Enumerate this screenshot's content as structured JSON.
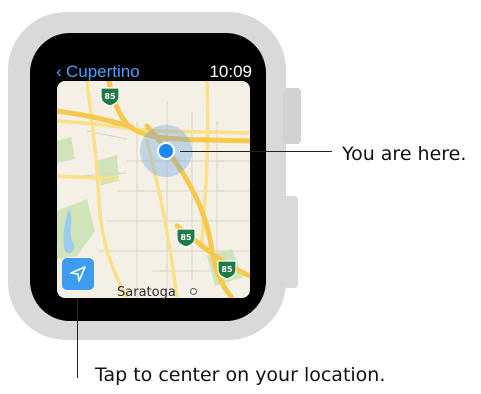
{
  "watch": {
    "back_chevron": "‹",
    "back_label": "Cupertino",
    "time": "10:09"
  },
  "map": {
    "highway_shields": [
      "85",
      "85",
      "85"
    ],
    "place_label": "Saratoga",
    "colors": {
      "land": "#f4f0e6",
      "park": "#cfe4b8",
      "water": "#9ccbf0",
      "highway": "#f6c84c",
      "major_road": "#fbe08a",
      "minor_road": "#d8d3c6",
      "shield": "#1f7a44",
      "location": "#1f87f2"
    }
  },
  "callouts": {
    "you_are_here": "You are here.",
    "tap_to_center": "Tap to center on your location."
  },
  "icons": {
    "locate_button": "location-arrow-icon",
    "location_marker": "current-location-icon",
    "back": "chevron-left-icon"
  }
}
